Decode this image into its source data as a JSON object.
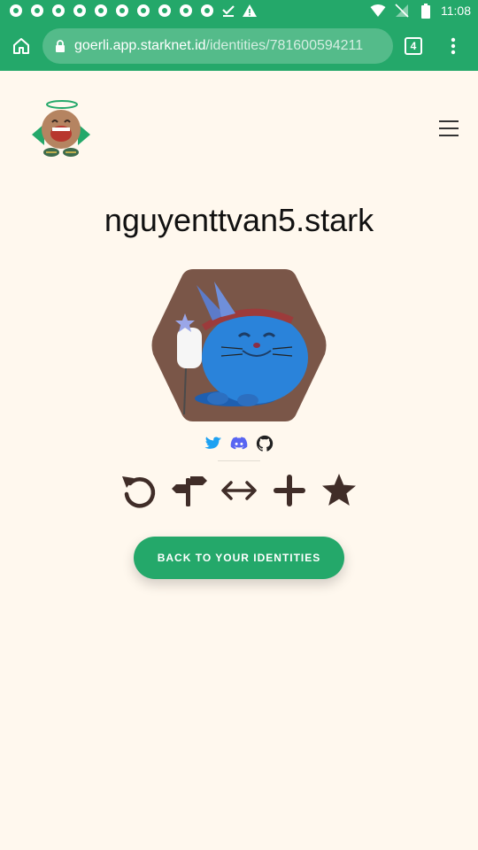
{
  "status_bar": {
    "time": "11:08",
    "notification_icons": [
      "chrome-icon",
      "chrome-icon",
      "chrome-icon",
      "chrome-icon",
      "chrome-icon",
      "chrome-icon",
      "chrome-icon",
      "chrome-icon",
      "chrome-icon",
      "chrome-icon",
      "check-icon",
      "warning-icon"
    ],
    "right_icons": [
      "wifi-icon",
      "signal-icon",
      "battery-icon"
    ]
  },
  "browser": {
    "url_host": "goerli.app.starknet.id",
    "url_path": "/identities/781600594211",
    "tab_count": "4",
    "icons": [
      "home-icon",
      "lock-icon",
      "tabs-icon",
      "more-vert-icon"
    ]
  },
  "header": {
    "logo_icon": "starknet-id-mascot-logo",
    "menu_icon": "hamburger-menu-icon"
  },
  "identity": {
    "name": "nguyenttvan5.stark",
    "avatar": "blue-cat-mascot-hexagon",
    "social_icons": [
      "twitter-icon",
      "discord-icon",
      "github-icon"
    ],
    "social_colors": {
      "twitter": "#1DA1F2",
      "discord": "#5865F2",
      "github": "#222222"
    },
    "action_icons": [
      "renew-icon",
      "signpost-icon",
      "transfer-arrows-icon",
      "add-subdomain-icon",
      "star-icon"
    ]
  },
  "back_button": {
    "label": "BACK TO YOUR IDENTITIES"
  },
  "colors": {
    "brand_green": "#24A86A",
    "page_background": "#FFF8EE",
    "action_icon": "#402D28",
    "avatar_background": "#7A5648"
  }
}
